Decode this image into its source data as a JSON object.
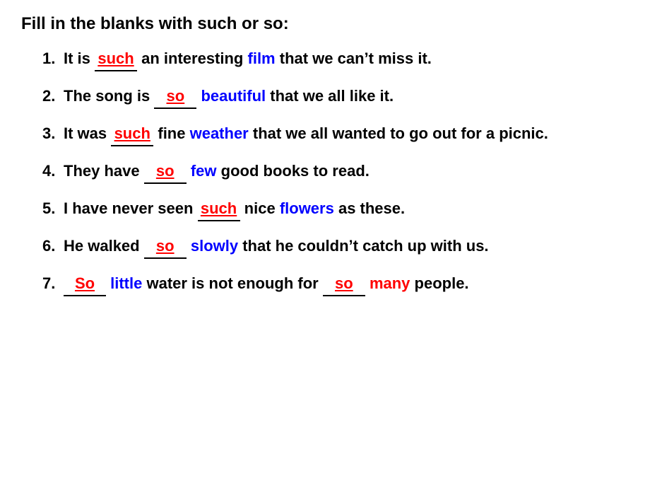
{
  "title": "Fill in the blanks with such or so:",
  "items": [
    {
      "id": 1,
      "parts": [
        {
          "text": "It is ",
          "type": "normal"
        },
        {
          "text": "such",
          "type": "answer"
        },
        {
          "text": " an interesting ",
          "type": "normal"
        },
        {
          "text": "film",
          "type": "blue"
        },
        {
          "text": " that we can’t miss it.",
          "type": "normal"
        }
      ]
    },
    {
      "id": 2,
      "parts": [
        {
          "text": "The song is ",
          "type": "normal"
        },
        {
          "text": "so",
          "type": "answer"
        },
        {
          "text": " ",
          "type": "normal"
        },
        {
          "text": "beautiful",
          "type": "blue"
        },
        {
          "text": " that we all like it.",
          "type": "normal"
        }
      ]
    },
    {
      "id": 3,
      "parts": [
        {
          "text": "It was ",
          "type": "normal"
        },
        {
          "text": "such",
          "type": "answer"
        },
        {
          "text": " fine ",
          "type": "normal"
        },
        {
          "text": "weather",
          "type": "blue"
        },
        {
          "text": " that we all wanted to go out for a picnic.",
          "type": "normal"
        }
      ]
    },
    {
      "id": 4,
      "parts": [
        {
          "text": "They have ",
          "type": "normal"
        },
        {
          "text": "so",
          "type": "answer"
        },
        {
          "text": " ",
          "type": "normal"
        },
        {
          "text": "few",
          "type": "blue"
        },
        {
          "text": " good books to read.",
          "type": "normal"
        }
      ]
    },
    {
      "id": 5,
      "parts": [
        {
          "text": "I have never seen ",
          "type": "normal"
        },
        {
          "text": "such",
          "type": "answer"
        },
        {
          "text": " nice ",
          "type": "normal"
        },
        {
          "text": "flowers",
          "type": "blue"
        },
        {
          "text": " as these.",
          "type": "normal"
        }
      ]
    },
    {
      "id": 6,
      "parts": [
        {
          "text": "He walked ",
          "type": "normal"
        },
        {
          "text": "so",
          "type": "answer"
        },
        {
          "text": " ",
          "type": "normal"
        },
        {
          "text": "slowly",
          "type": "blue"
        },
        {
          "text": " that he couldn’t catch up with us.",
          "type": "normal"
        }
      ]
    },
    {
      "id": 7,
      "parts": [
        {
          "text": "",
          "type": "normal"
        },
        {
          "text": "So",
          "type": "answer"
        },
        {
          "text": " ",
          "type": "normal"
        },
        {
          "text": "little",
          "type": "blue"
        },
        {
          "text": " water is not enough for ",
          "type": "normal"
        },
        {
          "text": "so",
          "type": "answer"
        },
        {
          "text": " ",
          "type": "normal"
        },
        {
          "text": "many",
          "type": "red"
        },
        {
          "text": " people.",
          "type": "normal"
        }
      ]
    }
  ]
}
